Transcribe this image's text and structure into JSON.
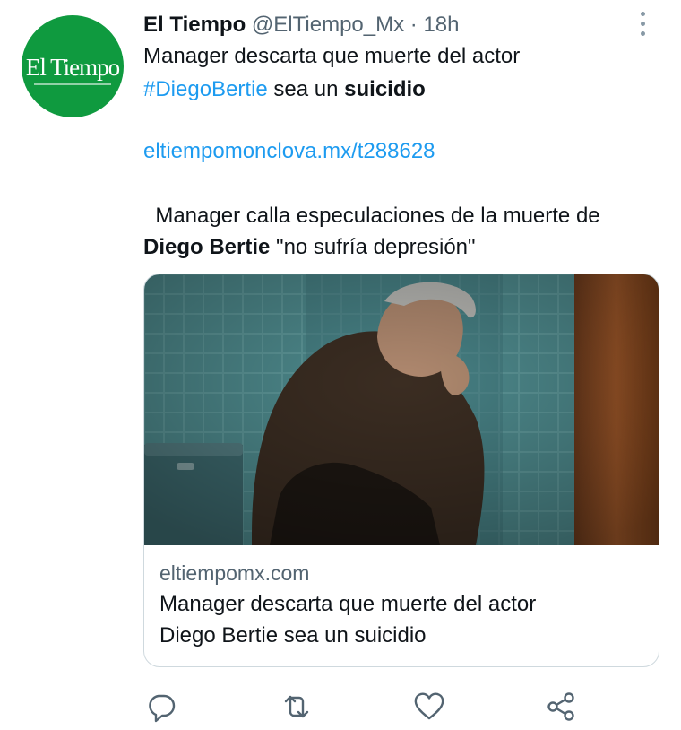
{
  "author": {
    "name": "El Tiempo",
    "handle": "@ElTiempo_Mx",
    "separator": "·",
    "time": "18h",
    "avatar_logo_text": "El Tiempo",
    "avatar_color": "#0f9a3f"
  },
  "tweet": {
    "line1": "Manager descarta que muerte del actor",
    "hashtag": "#DiegoBertie",
    "line2_middle": " sea un ",
    "line2_bold": "suicidio",
    "link": "eltiempomonclova.mx/t288628",
    "line3": "  Manager calla especulaciones de la muerte de",
    "line4_bold": "Diego Bertie",
    "line4_rest": " \"no sufría depresión\""
  },
  "card": {
    "domain": "eltiempomx.com",
    "title_line1": "Manager descarta que muerte del actor",
    "title_line2": "Diego Bertie sea un suicidio",
    "image_description_icon": "photo-man-sitting"
  },
  "actions": [
    {
      "icon": "reply-icon"
    },
    {
      "icon": "retweet-icon"
    },
    {
      "icon": "like-icon"
    },
    {
      "icon": "share-icon"
    }
  ],
  "colors": {
    "link": "#1d9bf0",
    "secondary_text": "#536471",
    "icon": "#536471"
  }
}
